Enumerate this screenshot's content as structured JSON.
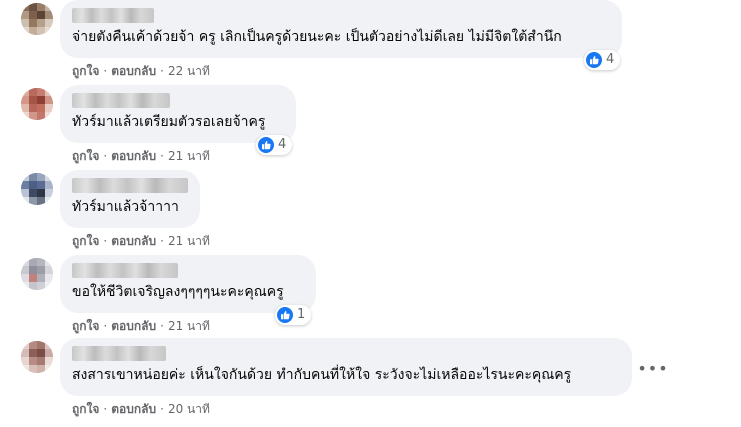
{
  "comments": [
    {
      "author": "",
      "text": "จ่ายตังคืนเค้าด้วยจ้า ครู เลิกเป็นครูด้วยนะคะ เป็นตัวอย่างไม่ดีเลย ไม่มีจิตใต้สำนึก",
      "reaction_icon": "like-icon",
      "reaction_count": "4",
      "like_label": "ถูกใจ",
      "reply_label": "ตอบกลับ",
      "time": "22 นาที"
    },
    {
      "author": "",
      "text": "ทัวร์มาแล้วเตรียมตัวรอเลยจ้าครู",
      "reaction_icon": "like-icon",
      "reaction_count": "4",
      "like_label": "ถูกใจ",
      "reply_label": "ตอบกลับ",
      "time": "21 นาที"
    },
    {
      "author": "",
      "text": "ทัวร์มาแล้วจ้าาาา",
      "like_label": "ถูกใจ",
      "reply_label": "ตอบกลับ",
      "time": "21 นาที"
    },
    {
      "author": "",
      "text": "ขอให้ชีวิตเจริญลงๆๆๆๆนะคะคุณครู",
      "reaction_icon": "like-icon",
      "reaction_count": "1",
      "like_label": "ถูกใจ",
      "reply_label": "ตอบกลับ",
      "time": "21 นาที"
    },
    {
      "author": "",
      "text": "สงสารเขาหน่อยค่ะ เห็นใจกันด้วย ทำกับคนที่ให้ใจ ระวังจะไม่เหลืออะไรนะคะคุณครู",
      "like_label": "ถูกใจ",
      "reply_label": "ตอบกลับ",
      "time": "20 นาที",
      "more_icon": "more-horizontal-icon"
    }
  ],
  "separator": "·",
  "colors": {
    "bubble": "#f0f2f5",
    "like_blue": "#1877f2",
    "meta_text": "#65676b",
    "body_text": "#050505"
  }
}
